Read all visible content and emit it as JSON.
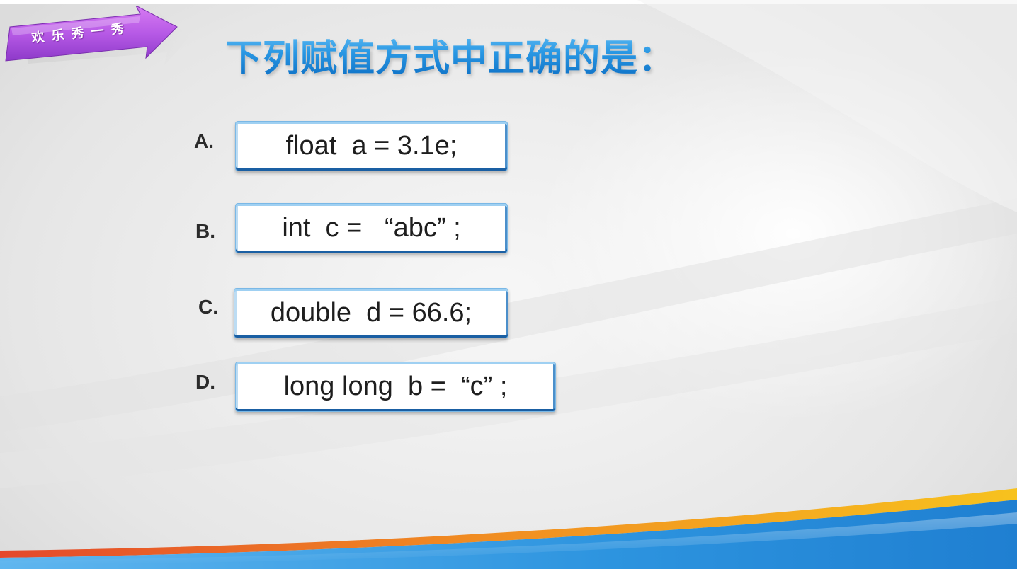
{
  "badge": {
    "label": "欢 乐 秀 一 秀"
  },
  "title": "下列赋值方式中正确的是：",
  "options": [
    {
      "letter": "A.",
      "code": "float  a = 3.1e;"
    },
    {
      "letter": "B.",
      "code": "int  c =   “abc” ;"
    },
    {
      "letter": "C.",
      "code": "double  d = 66.6;"
    },
    {
      "letter": "D.",
      "code": "long long  b =  “c” ;"
    }
  ],
  "colors": {
    "title_blue": "#1f8fde",
    "badge_purple": "#b75ae6",
    "box_border_blue": "#1a5fa3",
    "wave_orange": "#f6a21c",
    "wave_blue": "#2d94df",
    "wave_red": "#e43a2d"
  }
}
